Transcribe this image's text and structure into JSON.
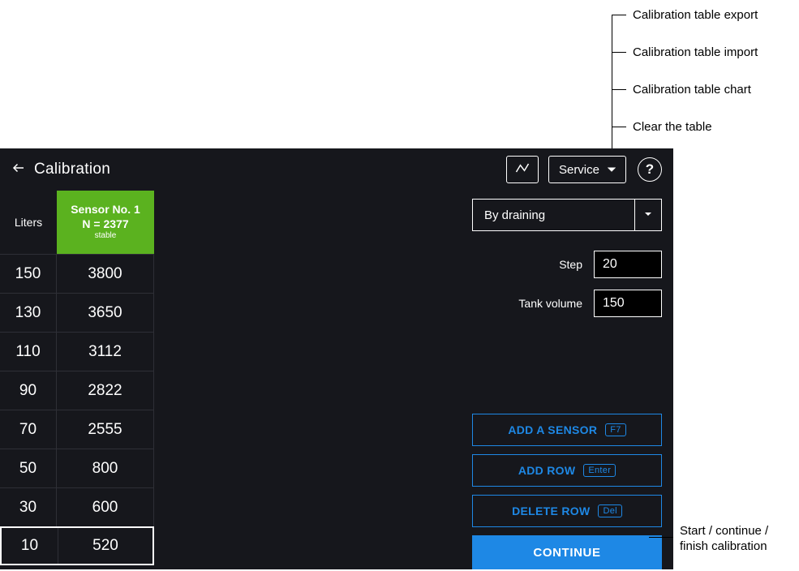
{
  "annotations": {
    "export": "Calibration table export",
    "import": "Calibration table import",
    "chart": "Calibration table chart",
    "clear": "Clear the table",
    "continue_l1": "Start / continue /",
    "continue_l2": "finish calibration"
  },
  "topbar": {
    "title": "Calibration",
    "service_label": "Service",
    "help_label": "?"
  },
  "table": {
    "liters_header": "Liters",
    "sensor_header_l1": "Sensor No. 1",
    "sensor_header_l2": "N = 2377",
    "sensor_header_l3": "stable",
    "rows": [
      {
        "liters": "150",
        "n": "3800",
        "sel": false
      },
      {
        "liters": "130",
        "n": "3650",
        "sel": false
      },
      {
        "liters": "110",
        "n": "3112",
        "sel": false
      },
      {
        "liters": "90",
        "n": "2822",
        "sel": false
      },
      {
        "liters": "70",
        "n": "2555",
        "sel": false
      },
      {
        "liters": "50",
        "n": "800",
        "sel": false
      },
      {
        "liters": "30",
        "n": "600",
        "sel": false
      },
      {
        "liters": "10",
        "n": "520",
        "sel": true
      }
    ]
  },
  "panel": {
    "mode_label": "By draining",
    "step_label": "Step",
    "step_value": "20",
    "tankvol_label": "Tank volume",
    "tankvol_value": "150",
    "add_sensor_label": "ADD A SENSOR",
    "add_sensor_key": "F7",
    "add_row_label": "ADD ROW",
    "add_row_key": "Enter",
    "del_row_label": "DELETE ROW",
    "del_row_key": "Del",
    "continue_label": "CONTINUE"
  }
}
